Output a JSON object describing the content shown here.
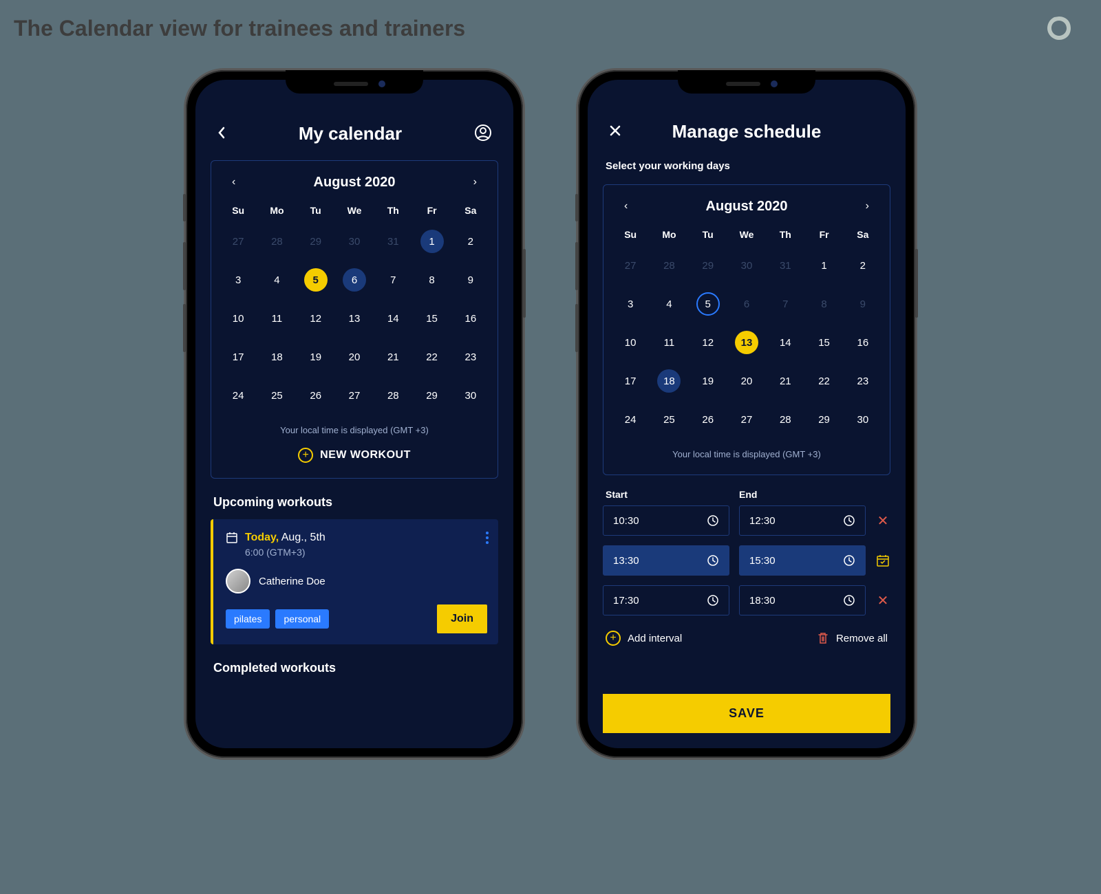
{
  "page": {
    "title": "The Calendar view for trainees and trainers"
  },
  "trainee": {
    "header": {
      "title": "My calendar"
    },
    "calendar": {
      "month_label": "August 2020",
      "dow": [
        "Su",
        "Mo",
        "Tu",
        "We",
        "Th",
        "Fr",
        "Sa"
      ],
      "days": [
        {
          "n": "27",
          "muted": true
        },
        {
          "n": "28",
          "muted": true
        },
        {
          "n": "29",
          "muted": true
        },
        {
          "n": "30",
          "muted": true
        },
        {
          "n": "31",
          "muted": true
        },
        {
          "n": "1",
          "style": "dark-blue"
        },
        {
          "n": "2"
        },
        {
          "n": "3"
        },
        {
          "n": "4"
        },
        {
          "n": "5",
          "style": "yellow"
        },
        {
          "n": "6",
          "style": "dark-blue"
        },
        {
          "n": "7"
        },
        {
          "n": "8"
        },
        {
          "n": "9"
        },
        {
          "n": "10"
        },
        {
          "n": "11"
        },
        {
          "n": "12"
        },
        {
          "n": "13"
        },
        {
          "n": "14"
        },
        {
          "n": "15"
        },
        {
          "n": "16"
        },
        {
          "n": "17"
        },
        {
          "n": "18"
        },
        {
          "n": "19"
        },
        {
          "n": "20"
        },
        {
          "n": "21"
        },
        {
          "n": "22"
        },
        {
          "n": "23"
        },
        {
          "n": "24"
        },
        {
          "n": "25"
        },
        {
          "n": "26"
        },
        {
          "n": "27"
        },
        {
          "n": "28"
        },
        {
          "n": "29"
        },
        {
          "n": "30"
        }
      ],
      "tz_note": "Your local time is displayed (GMT +3)",
      "new_workout_label": "NEW WORKOUT"
    },
    "upcoming_title": "Upcoming workouts",
    "workout": {
      "today_label": "Today,",
      "date_rest": " Aug., 5th",
      "time": "6:00 (GTM+3)",
      "trainer": "Catherine Doe",
      "tags": [
        "pilates",
        "personal"
      ],
      "join_label": "Join"
    },
    "completed_title": "Completed workouts"
  },
  "trainer": {
    "header": {
      "title": "Manage schedule"
    },
    "subtitle": "Select your working days",
    "calendar": {
      "month_label": "August 2020",
      "dow": [
        "Su",
        "Mo",
        "Tu",
        "We",
        "Th",
        "Fr",
        "Sa"
      ],
      "days": [
        {
          "n": "27",
          "muted": true
        },
        {
          "n": "28",
          "muted": true
        },
        {
          "n": "29",
          "muted": true
        },
        {
          "n": "30",
          "muted": true
        },
        {
          "n": "31",
          "muted": true
        },
        {
          "n": "1"
        },
        {
          "n": "2"
        },
        {
          "n": "3"
        },
        {
          "n": "4"
        },
        {
          "n": "5",
          "style": "outline"
        },
        {
          "n": "6",
          "muted": true
        },
        {
          "n": "7",
          "muted": true
        },
        {
          "n": "8",
          "muted": true
        },
        {
          "n": "9",
          "muted": true
        },
        {
          "n": "10"
        },
        {
          "n": "11"
        },
        {
          "n": "12"
        },
        {
          "n": "13",
          "style": "yellow"
        },
        {
          "n": "14"
        },
        {
          "n": "15"
        },
        {
          "n": "16"
        },
        {
          "n": "17"
        },
        {
          "n": "18",
          "style": "dark-blue"
        },
        {
          "n": "19"
        },
        {
          "n": "20"
        },
        {
          "n": "21"
        },
        {
          "n": "22"
        },
        {
          "n": "23"
        },
        {
          "n": "24"
        },
        {
          "n": "25"
        },
        {
          "n": "26"
        },
        {
          "n": "27"
        },
        {
          "n": "28"
        },
        {
          "n": "29"
        },
        {
          "n": "30"
        }
      ],
      "tz_note": "Your local time is displayed (GMT +3)"
    },
    "intervals": {
      "start_label": "Start",
      "end_label": "End",
      "rows": [
        {
          "start": "10:30",
          "end": "12:30",
          "action": "remove",
          "active": false
        },
        {
          "start": "13:30",
          "end": "15:30",
          "action": "calendar",
          "active": true
        },
        {
          "start": "17:30",
          "end": "18:30",
          "action": "remove",
          "active": false
        }
      ],
      "add_label": "Add interval",
      "remove_all_label": "Remove all"
    },
    "save_label": "SAVE"
  }
}
